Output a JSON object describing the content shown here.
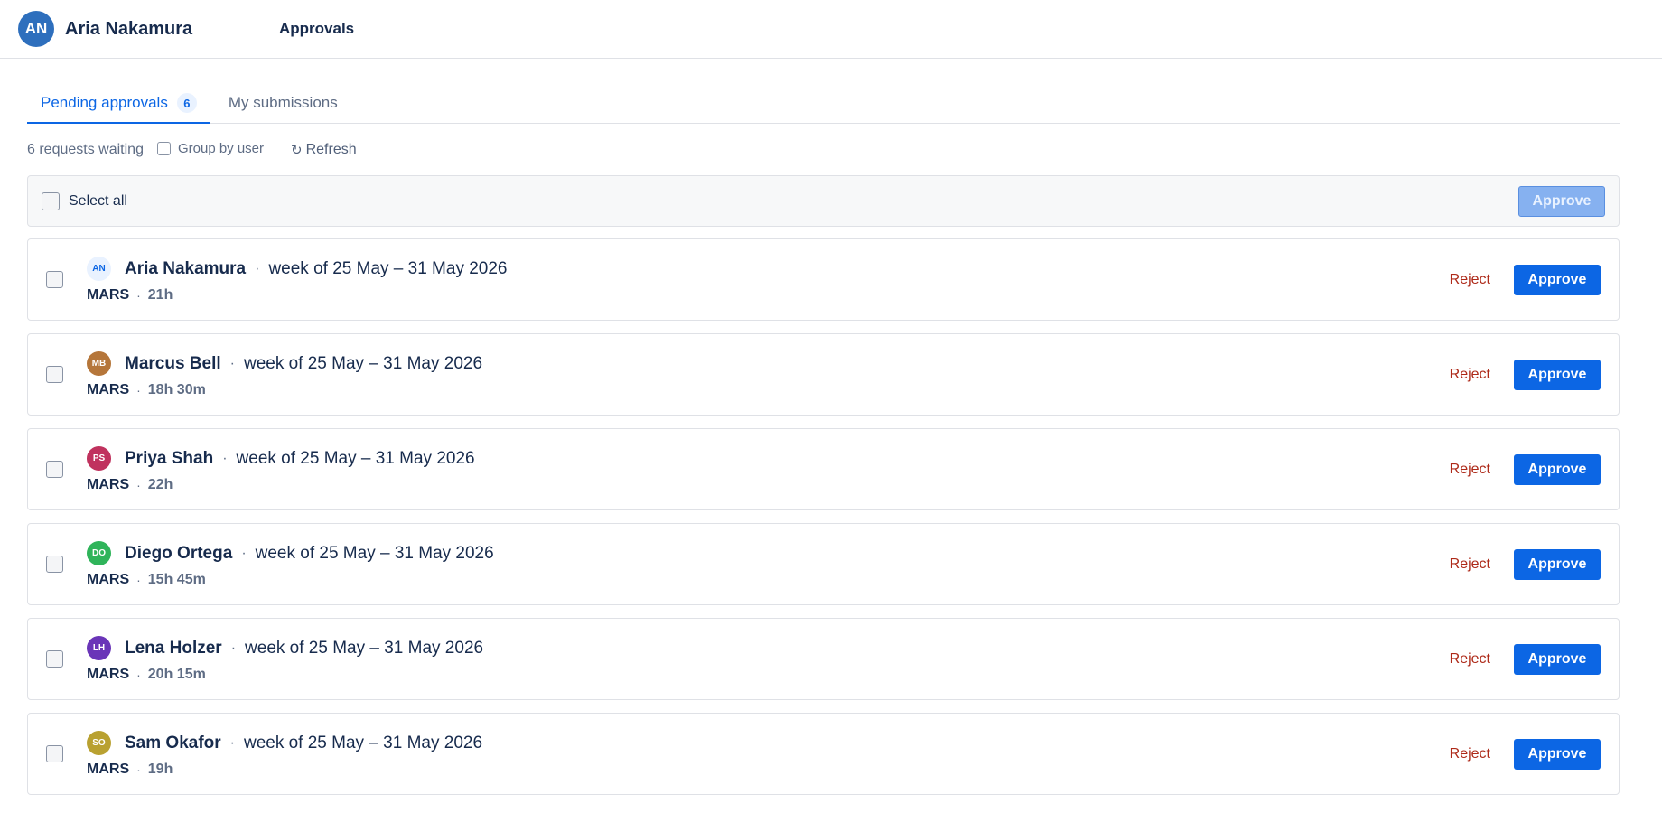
{
  "header": {
    "user_initials": "AN",
    "user_name": "Aria Nakamura",
    "nav_approvals": "Approvals"
  },
  "tabs": {
    "pending_label": "Pending approvals",
    "pending_count": "6",
    "submissions_label": "My submissions"
  },
  "toolbar": {
    "waiting_text": "6 requests waiting",
    "group_by_label": "Group by user",
    "refresh_label": "Refresh",
    "refresh_icon": "refresh-icon"
  },
  "select_bar": {
    "select_all_label": "Select all",
    "approve_label": "Approve"
  },
  "rows": [
    {
      "initials": "AN",
      "name": "Aria Nakamura",
      "week": "week of 25 May – 31 May 2026",
      "project": "MARS",
      "hours": "21h",
      "avatar_color": "#e9f2ff",
      "reject_label": "Reject",
      "approve_label": "Approve"
    },
    {
      "initials": "MB",
      "name": "Marcus Bell",
      "week": "week of 25 May – 31 May 2026",
      "project": "MARS",
      "hours": "18h 30m",
      "avatar_color": "#b5763a",
      "reject_label": "Reject",
      "approve_label": "Approve"
    },
    {
      "initials": "PS",
      "name": "Priya Shah",
      "week": "week of 25 May – 31 May 2026",
      "project": "MARS",
      "hours": "22h",
      "avatar_color": "#c0325e",
      "reject_label": "Reject",
      "approve_label": "Approve"
    },
    {
      "initials": "DO",
      "name": "Diego Ortega",
      "week": "week of 25 May – 31 May 2026",
      "project": "MARS",
      "hours": "15h 45m",
      "avatar_color": "#2fb45a",
      "reject_label": "Reject",
      "approve_label": "Approve"
    },
    {
      "initials": "LH",
      "name": "Lena Holzer",
      "week": "week of 25 May – 31 May 2026",
      "project": "MARS",
      "hours": "20h 15m",
      "avatar_color": "#6a35b8",
      "reject_label": "Reject",
      "approve_label": "Approve"
    },
    {
      "initials": "SO",
      "name": "Sam Okafor",
      "week": "week of 25 May – 31 May 2026",
      "project": "MARS",
      "hours": "19h",
      "avatar_color": "#b9a131",
      "reject_label": "Reject",
      "approve_label": "Approve"
    }
  ],
  "colors": {
    "primary": "#0c66e4",
    "reject": "#ae2a19",
    "header_avatar": "#2e6fbd"
  }
}
